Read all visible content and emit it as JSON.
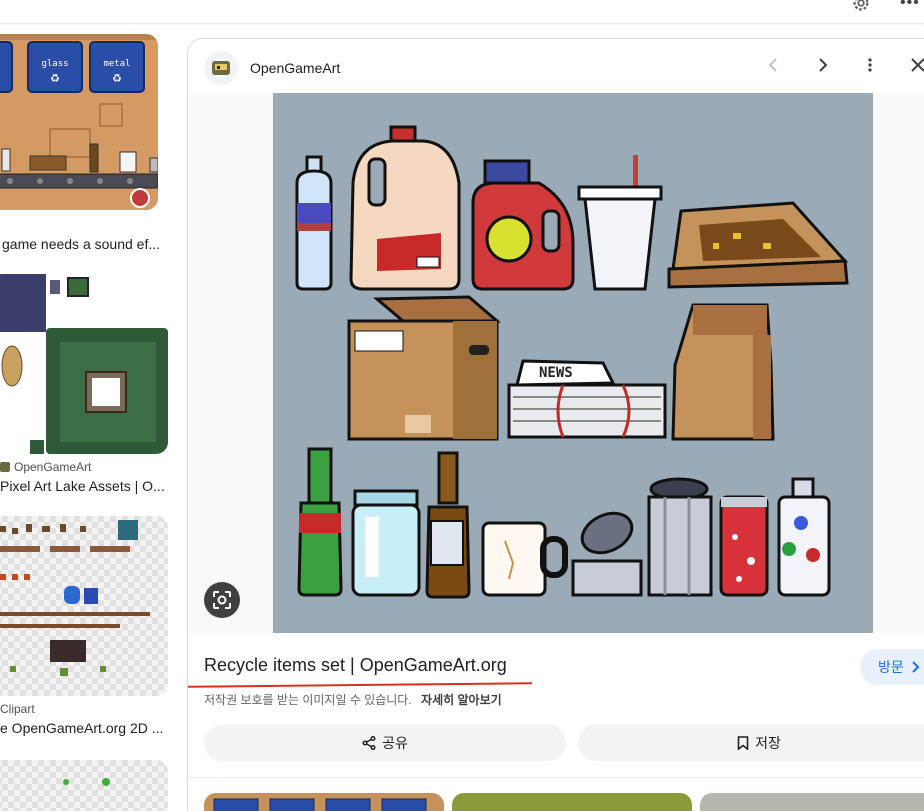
{
  "results": [
    {
      "caption": "game needs a sound ef...",
      "source": ""
    },
    {
      "caption": "Pixel Art Lake Assets | O...",
      "source": "OpenGameArt"
    },
    {
      "caption": "e OpenGameArt.org 2D ...",
      "source": "Clipart"
    }
  ],
  "thumb1": {
    "bin_glass": "glass",
    "bin_metal": "metal"
  },
  "panel": {
    "site_name": "OpenGameArt",
    "title": "Recycle items set | OpenGameArt.org",
    "visit_label": "방문",
    "copyright_text": "저작권 보호를 받는 이미지일 수 있습니다.",
    "learn_more": "자세히 알아보기",
    "share_label": "공유",
    "save_label": "저장",
    "newspaper_text": "NEWS"
  },
  "icons": {
    "prev": "chevron-left-icon",
    "next": "chevron-right-icon",
    "more": "more-vert-icon",
    "close": "close-icon",
    "lens": "lens-icon",
    "share": "share-icon",
    "save": "bookmark-icon",
    "settings": "gear-icon"
  },
  "colors": {
    "accent_blue": "#1a73e8",
    "visit_bg": "#e8f0fe",
    "underline_red": "#d93025",
    "preview_bg": "#9aabb7"
  }
}
